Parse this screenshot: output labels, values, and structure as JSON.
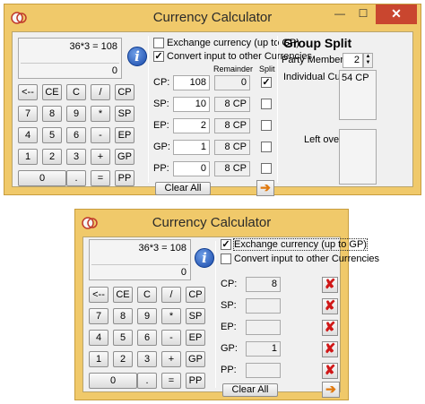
{
  "window1": {
    "title": "Currency Calculator",
    "display": {
      "expression": "36*3 = 108",
      "result": "0"
    },
    "keypad": [
      "<--",
      "CE",
      "C",
      "/",
      "CP",
      "7",
      "8",
      "9",
      "*",
      "SP",
      "4",
      "5",
      "6",
      "-",
      "EP",
      "1",
      "2",
      "3",
      "+",
      "GP",
      "0",
      ".",
      "=",
      "PP"
    ],
    "options": {
      "exchange_label": "Exchange currency (up to GP)",
      "exchange_checked": false,
      "convert_label": "Convert input to other Currencies",
      "convert_checked": true
    },
    "headers": {
      "remainder": "Remainder",
      "split": "Split"
    },
    "rows": [
      {
        "label": "CP:",
        "value": "108",
        "remainder": "0",
        "split": true
      },
      {
        "label": "SP:",
        "value": "10",
        "remainder": "8 CP",
        "split": false
      },
      {
        "label": "EP:",
        "value": "2",
        "remainder": "8 CP",
        "split": false
      },
      {
        "label": "GP:",
        "value": "1",
        "remainder": "8 CP",
        "split": false
      },
      {
        "label": "PP:",
        "value": "0",
        "remainder": "8 CP",
        "split": false
      }
    ],
    "clear_all": "Clear All",
    "arrow": "➔",
    "group_split": {
      "title": "Group Split",
      "members_label": "Party Members:",
      "members_value": "2",
      "cut_label": "Individual Cut:",
      "cut_value": "54 CP",
      "left_label": "Left over:",
      "left_value": ""
    }
  },
  "window2": {
    "title": "Currency Calculator",
    "display": {
      "expression": "36*3 = 108",
      "result": "0"
    },
    "keypad": [
      "<--",
      "CE",
      "C",
      "/",
      "CP",
      "7",
      "8",
      "9",
      "*",
      "SP",
      "4",
      "5",
      "6",
      "-",
      "EP",
      "1",
      "2",
      "3",
      "+",
      "GP",
      "0",
      ".",
      "=",
      "PP"
    ],
    "options": {
      "exchange_label": "Exchange currency (up to GP)",
      "exchange_checked": true,
      "convert_label": "Convert input to other Currencies",
      "convert_checked": false
    },
    "rows": [
      {
        "label": "CP:",
        "value": "8"
      },
      {
        "label": "SP:",
        "value": ""
      },
      {
        "label": "EP:",
        "value": ""
      },
      {
        "label": "GP:",
        "value": "1"
      },
      {
        "label": "PP:",
        "value": ""
      }
    ],
    "clear_all": "Clear All",
    "arrow": "➔",
    "delete_glyph": "✘"
  },
  "window_controls": {
    "minimize": "—",
    "maximize": "☐",
    "close": "✕"
  },
  "app_icon_text": "€",
  "colors": {
    "frame": "#f0c96a",
    "close": "#c9462f",
    "client": "#f0f0f0",
    "info": "#1848a8",
    "delete": "#d01818",
    "arrow": "#e0790f"
  },
  "icons": {
    "app": "coins-app-icon",
    "info": "info-icon",
    "clear": "red-x-icon",
    "apply": "orange-arrow-icon"
  }
}
